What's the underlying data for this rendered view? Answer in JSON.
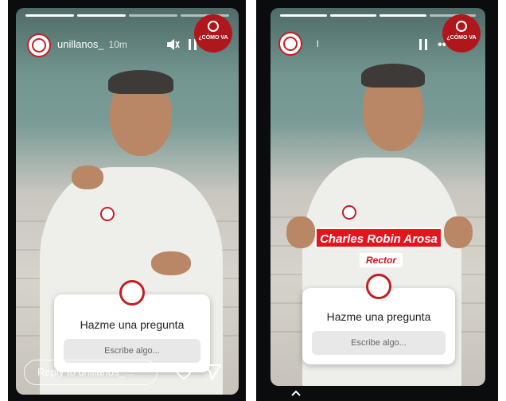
{
  "left_story": {
    "username": "unillanos_",
    "time": "10m",
    "controls": {
      "mute_icon": "speaker-muted-icon",
      "pause_icon": "pause-icon",
      "more_icon": "more-icon"
    },
    "badge_text": "¿CÓMO VA",
    "question": {
      "title": "Hazme una pregunta",
      "placeholder": "Escribe algo..."
    },
    "reply_placeholder": "Reply to unillanos_...",
    "actions": {
      "like_icon": "heart-icon",
      "share_icon": "send-icon"
    }
  },
  "right_story": {
    "status_text": "l",
    "controls": {
      "pause_icon": "pause-icon",
      "more_icon": "more-icon"
    },
    "badge_text": "¿CÓMO VA",
    "lower_third": {
      "name": "Charles Robin Arosa",
      "role": "Rector"
    },
    "question": {
      "title": "Hazme una pregunta",
      "placeholder": "Escribe algo..."
    },
    "swipe_icon": "chevron-up-icon"
  },
  "colors": {
    "brand_red": "#c41e24",
    "name_plate_red": "#e2141c"
  }
}
